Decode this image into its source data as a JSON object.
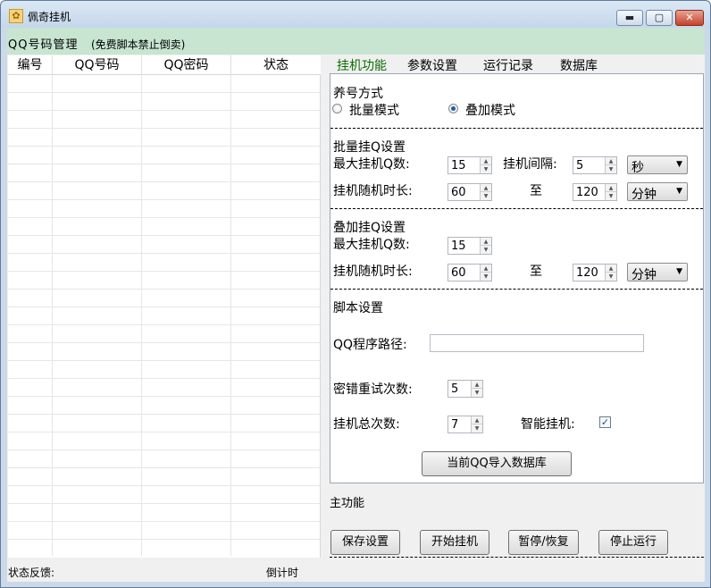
{
  "window": {
    "title": "佩奇挂机",
    "icon": "app-icon",
    "controls": {
      "minimize": "▬",
      "maximize": "▢",
      "close": "✕"
    }
  },
  "group": {
    "title": "QQ号码管理",
    "note": "(免费脚本禁止倒卖)"
  },
  "grid": {
    "columns": [
      "编号",
      "QQ号码",
      "QQ密码",
      "状态"
    ],
    "rows": []
  },
  "tabs": [
    {
      "label": "挂机功能",
      "active": true
    },
    {
      "label": "参数设置",
      "active": false
    },
    {
      "label": "运行记录",
      "active": false
    },
    {
      "label": "数据库",
      "active": false
    }
  ],
  "mode": {
    "title": "养号方式",
    "options": [
      {
        "label": "批量模式",
        "checked": false
      },
      {
        "label": "叠加模式",
        "checked": true
      }
    ]
  },
  "batch": {
    "title": "批量挂Q设置",
    "max_label": "最大挂机Q数:",
    "max_value": "15",
    "interval_label": "挂机间隔:",
    "interval_value": "5",
    "interval_unit": "秒",
    "duration_label": "挂机随机时长:",
    "duration_min": "60",
    "to_label": "至",
    "duration_max": "120",
    "duration_unit": "分钟"
  },
  "stack": {
    "title": "叠加挂Q设置",
    "max_label": "最大挂机Q数:",
    "max_value": "15",
    "duration_label": "挂机随机时长:",
    "duration_min": "60",
    "to_label": "至",
    "duration_max": "120",
    "duration_unit": "分钟"
  },
  "script": {
    "title": "脚本设置",
    "path_label": "QQ程序路径:",
    "path_value": "",
    "retry_label": "密错重试次数:",
    "retry_value": "5",
    "total_label": "挂机总次数:",
    "total_value": "7",
    "smart_label": "智能挂机:",
    "smart_checked": true,
    "import_button": "当前QQ导入数据库"
  },
  "main": {
    "title": "主功能",
    "buttons": [
      "保存设置",
      "开始挂机",
      "暂停/恢复",
      "停止运行"
    ]
  },
  "status": {
    "feedback_label": "状态反馈:",
    "countdown_label": "倒计时"
  },
  "colors": {
    "header_bg": "#c7e5d0",
    "active_tab": "#0a6e00",
    "window_frame": "#cbd9e8"
  }
}
